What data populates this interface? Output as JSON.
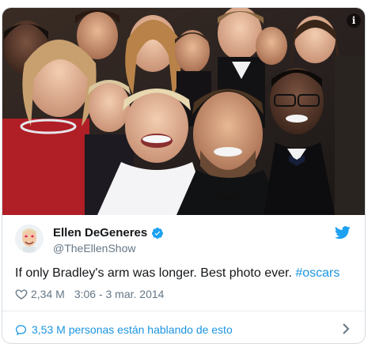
{
  "tweet": {
    "author_name": "Ellen DeGeneres",
    "handle": "@TheEllenShow",
    "text_main": "If only Bradley's arm was longer. Best photo ever. ",
    "hashtag": "#oscars",
    "likes": "2,34 M",
    "timestamp": "3:06 - 3 mar. 2014",
    "conversation": "3,53 M personas están hablando de esto",
    "info_symbol": "i"
  },
  "colors": {
    "link": "#1b95e0",
    "verified": "#1da1f2",
    "text": "#14171a",
    "muted": "#657786",
    "border": "#d7dde2"
  },
  "icons": {
    "verified": "verified-badge-icon",
    "bird": "twitter-bird-icon",
    "heart": "heart-icon",
    "comment": "comment-bubble-icon",
    "chevron": "chevron-right-icon",
    "info": "info-icon"
  }
}
